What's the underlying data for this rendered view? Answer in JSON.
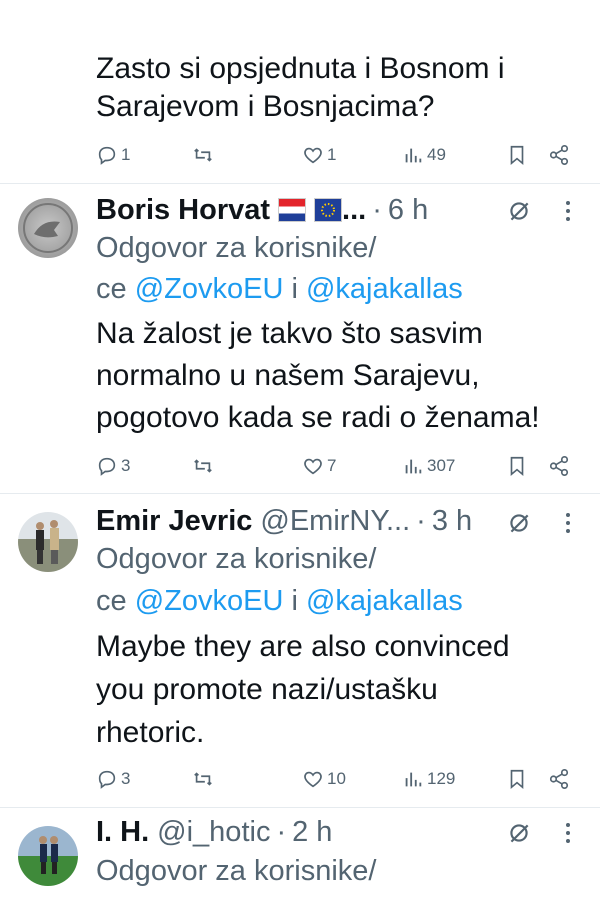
{
  "tweet0": {
    "text_line1": "Zasto si opsjednuta i Bosnom i",
    "text_line2": "Sarajevom i Bosnjacima?",
    "replies": "1",
    "retweets": "",
    "likes": "1",
    "views": "49"
  },
  "tweet1": {
    "name": "Boris Horvat",
    "flags": [
      "croatia-flag",
      "eu-flag"
    ],
    "name_suffix": "...",
    "time": "6 h",
    "reply_prefix_line1": "Odgovor za korisnike/",
    "reply_prefix_line2": "ce",
    "mention1": "@ZovkoEU",
    "joiner": "i",
    "mention2": "@kajakallas",
    "text_line1": "Na žalost je takvo što sasvim",
    "text_line2": "normalno u našem Sarajevu,",
    "text_line3": "pogotovo kada se radi o ženama!",
    "replies": "3",
    "likes": "7",
    "views": "307"
  },
  "tweet2": {
    "name": "Emir Jevric",
    "handle": "@EmirNY...",
    "time": "3 h",
    "reply_prefix_line1": "Odgovor za korisnike/",
    "reply_prefix_line2": "ce",
    "mention1": "@ZovkoEU",
    "joiner": "i",
    "mention2": "@kajakallas",
    "text_line1": "Maybe they are also convinced",
    "text_line2": "you promote nazi/ustašku",
    "text_line3": "rhetoric.",
    "replies": "3",
    "likes": "10",
    "views": "129"
  },
  "tweet3": {
    "name": "I. H.",
    "handle": "@i_hotic",
    "time": "2 h",
    "reply_prefix_line1": "Odgovor za korisnike/"
  },
  "icons": [
    "reply-icon",
    "retweet-icon",
    "like-icon",
    "views-icon",
    "bookmark-icon",
    "share-icon",
    "grok-icon",
    "more-icon"
  ],
  "colors": {
    "link": "#1d9bf0",
    "secondary": "#536471",
    "text": "#0f1419",
    "divider": "#e6ebef"
  }
}
